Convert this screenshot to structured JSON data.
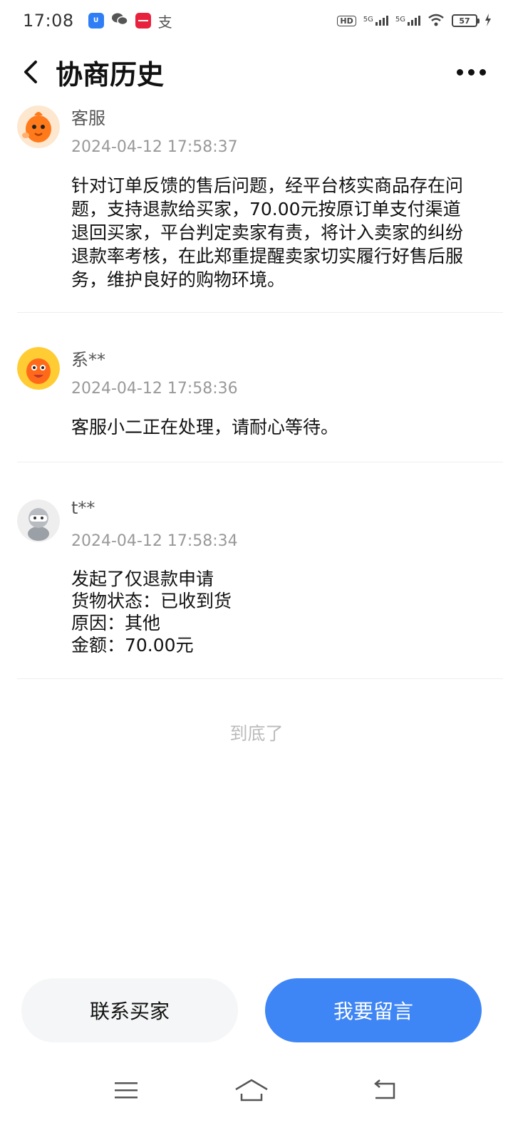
{
  "status_bar": {
    "time": "17:08",
    "apps": [
      {
        "icon": "blue-app-icon",
        "label": "U",
        "color": "#2f7ef6"
      },
      {
        "icon": "wechat-icon",
        "label": "",
        "color": "#555555"
      },
      {
        "icon": "red-app-icon",
        "label": "",
        "color": "#e8213d"
      },
      {
        "icon": "alipay-icon",
        "label": "支",
        "color": "#555555"
      }
    ],
    "hd_label": "HD",
    "network_1": "5G",
    "network_2": "5G",
    "battery": "57"
  },
  "header": {
    "title": "协商历史"
  },
  "entries": [
    {
      "author": "客服",
      "timestamp": "2024-04-12 17:58:37",
      "avatar": "service-mascot-avatar",
      "body": "针对订单反馈的售后问题，经平台核实商品存在问\n题，支持退款给买家，70.00元按原订单支付渠道\n退回买家，平台判定卖家有责，将计入卖家的纠纷\n退款率考核，在此郑重提醒卖家切实履行好售后服\n务，维护良好的购物环境。"
    },
    {
      "author": "系**",
      "timestamp": "2024-04-12 17:58:36",
      "avatar": "system-mascot-avatar",
      "body": "客服小二正在处理，请耐心等待。"
    },
    {
      "author": "t**",
      "timestamp": "2024-04-12 17:58:34",
      "avatar": "user-avatar",
      "body": "发起了仅退款申请\n货物状态：已收到货\n原因：其他\n金额：70.00元"
    }
  ],
  "end_hint": "到底了",
  "actions": {
    "contact_label": "联系买家",
    "message_label": "我要留言"
  },
  "colors": {
    "accent": "#3e85f5",
    "secondary_button": "#f5f6f7",
    "muted_text": "#999999"
  }
}
